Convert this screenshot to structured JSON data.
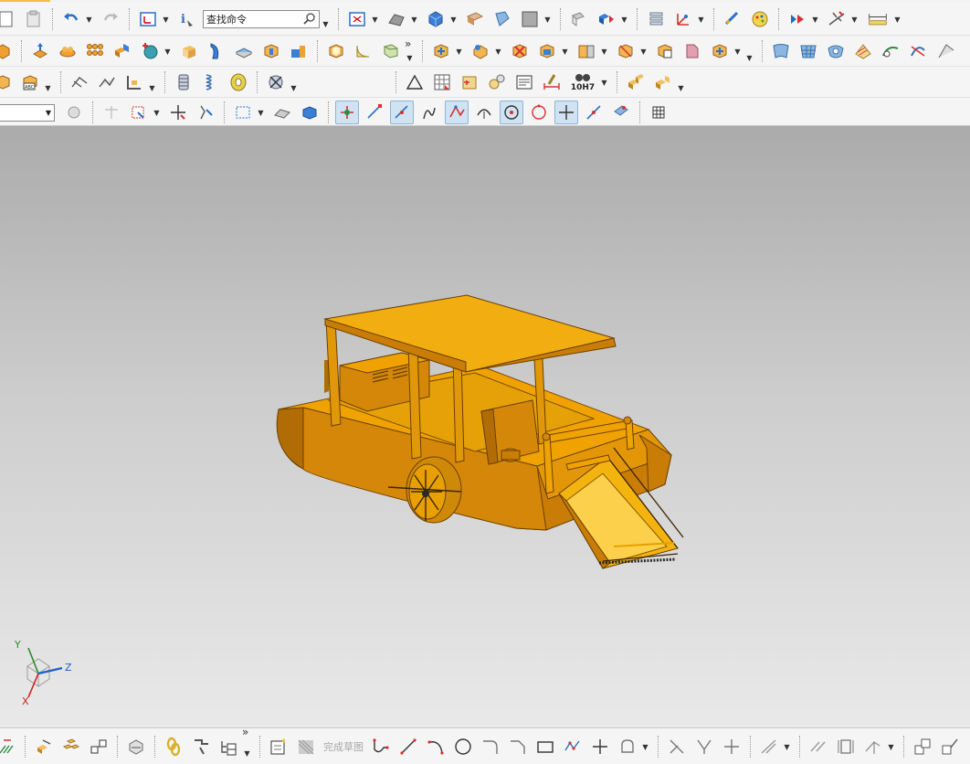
{
  "toolbar": {
    "search_placeholder": "查找命令",
    "bottom_finish_sketch_label": "完成草图",
    "ten_h7_label": "10H7",
    "more_glyph": "»"
  },
  "viewport": {
    "model": "boat-harvester-3d-model",
    "background_top": "#ababab",
    "background_bottom": "#e9e9e9",
    "model_color": "#f2a900"
  },
  "triad": {
    "x_label": "X",
    "y_label": "Y",
    "z_label": "Z"
  },
  "colors": {
    "accent_blue": "#2a6fc9",
    "toggle_active_bg": "#cfe3f2"
  }
}
